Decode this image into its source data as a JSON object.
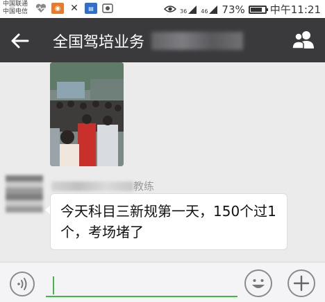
{
  "status_bar": {
    "carrier_1": "中国联通",
    "carrier_2": "中国电信",
    "signal_1": "36",
    "signal_2": "46",
    "battery_percent": "73%",
    "battery_level": 0.73,
    "time": "中午11:21",
    "icons": [
      "heart-pulse-icon",
      "app-icon",
      "app-icon",
      "app-icon",
      "image-icon",
      "eye-icon",
      "signal-icon",
      "battery-icon"
    ]
  },
  "title_bar": {
    "title": "全国驾培业务",
    "back_icon": "back-arrow-icon",
    "group_icon": "group-members-icon"
  },
  "chat": {
    "messages": [
      {
        "type": "image",
        "image_icon": "crowd-photo"
      },
      {
        "type": "text",
        "sender": "教练",
        "text": "今天科目三新规第一天，150个过1个，考场堵了"
      }
    ]
  },
  "input_bar": {
    "voice_icon": "voice-icon",
    "input_value": "",
    "emoji_icon": "emoji-icon",
    "plus_icon": "plus-icon",
    "accent_color": "#45b44a"
  }
}
